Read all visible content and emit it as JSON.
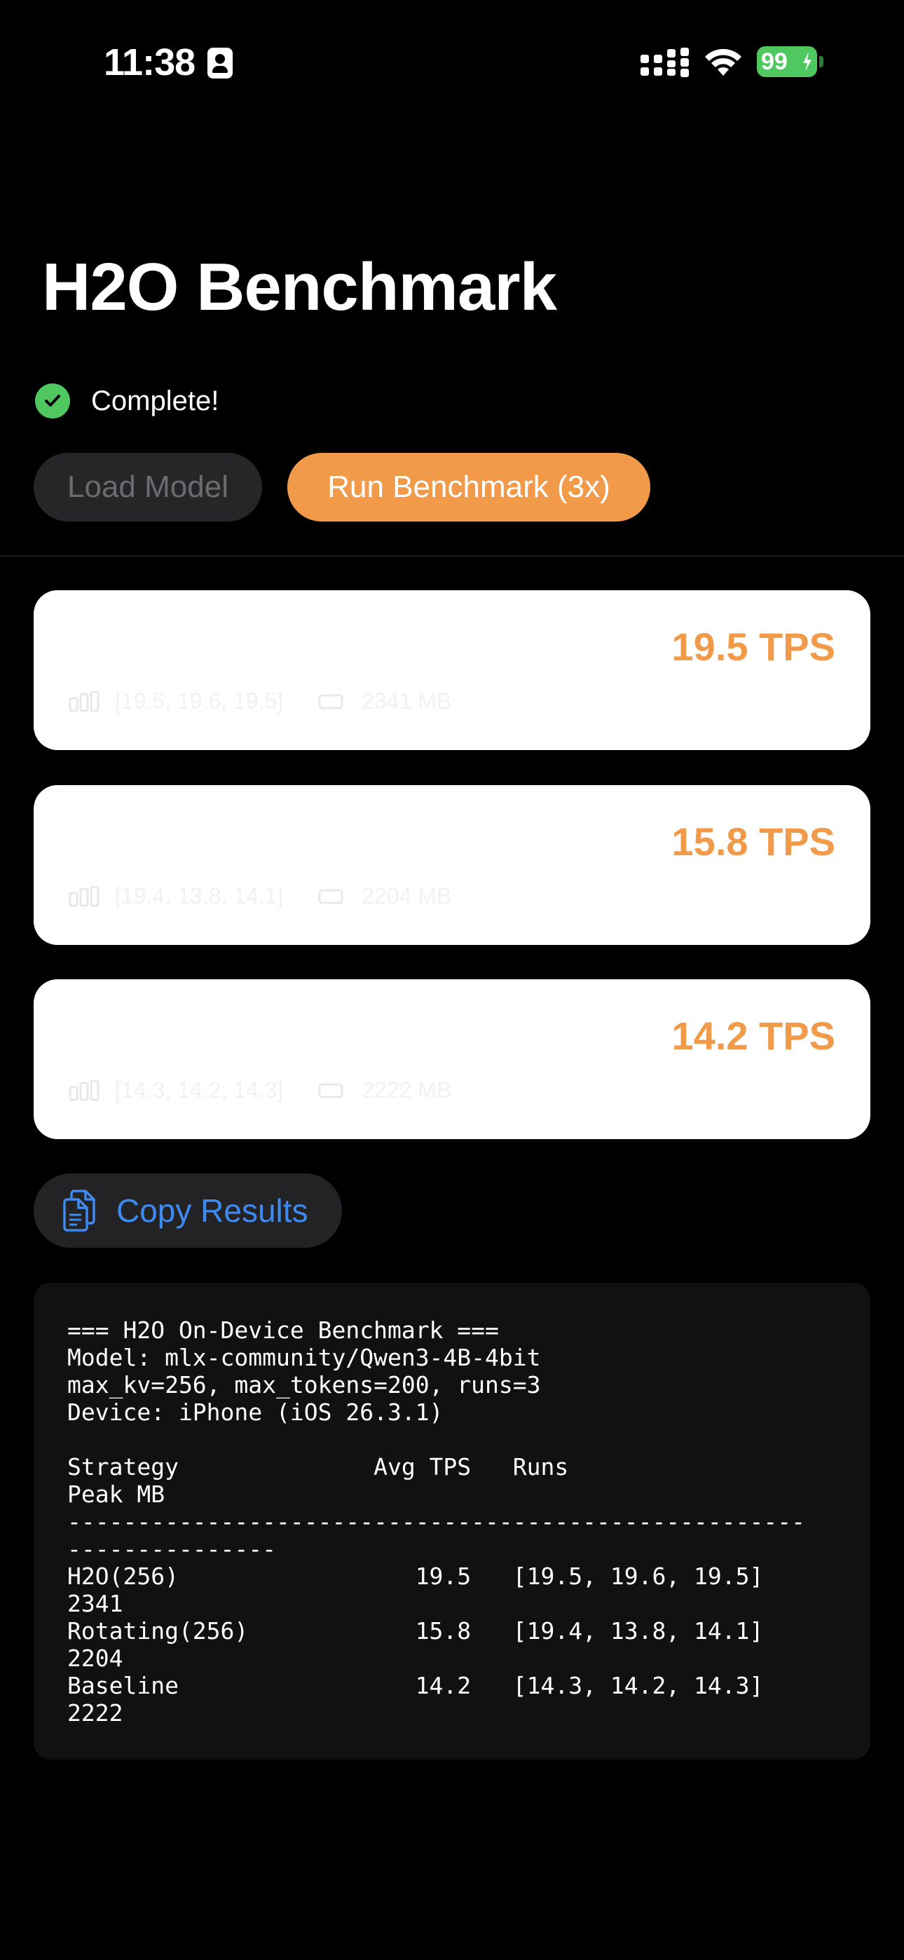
{
  "status_bar": {
    "time": "11:38",
    "battery": "99"
  },
  "title": "H2O Benchmark",
  "status": {
    "text": "Complete!"
  },
  "buttons": {
    "load_model": "Load Model",
    "run_benchmark": "Run Benchmark (3x)",
    "copy_results": "Copy Results"
  },
  "results": [
    {
      "tps": "19.5 TPS",
      "runs": "[19.5, 19.6, 19.5]",
      "memory": "2341 MB"
    },
    {
      "tps": "15.8 TPS",
      "runs": "[19.4, 13.8, 14.1]",
      "memory": "2204 MB"
    },
    {
      "tps": "14.2 TPS",
      "runs": "[14.3, 14.2, 14.3]",
      "memory": "2222 MB"
    }
  ],
  "report": {
    "lines": [
      "=== H2O On-Device Benchmark ===",
      "Model: mlx-community/Qwen3-4B-4bit",
      "max_kv=256, max_tokens=200, runs=3",
      "Device: iPhone (iOS 26.3.1)",
      "",
      "Strategy              Avg TPS   Runs",
      "Peak MB",
      "-----------------------------------------------------",
      "---------------",
      "H2O(256)                 19.5   [19.5, 19.6, 19.5]",
      "2341",
      "Rotating(256)            15.8   [19.4, 13.8, 14.1]",
      "2204",
      "Baseline                 14.2   [14.3, 14.2, 14.3]",
      "2222"
    ]
  },
  "colors": {
    "accent": "#f09a4a",
    "success": "#4fc95f",
    "link": "#3d8bf0",
    "background": "#000000"
  },
  "icons": {
    "status": "checkmark-circle-icon",
    "runs": "chart-bars-icon",
    "memory": "memory-chip-icon",
    "copy": "doc-on-doc-icon"
  }
}
